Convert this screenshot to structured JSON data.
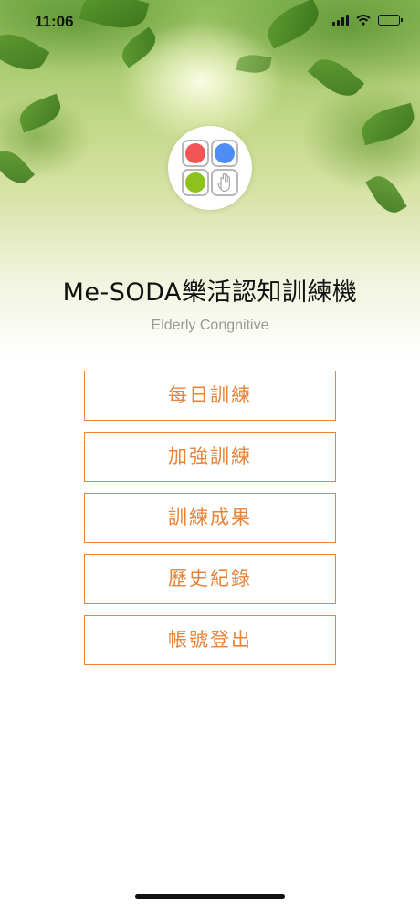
{
  "status_bar": {
    "time": "11:06"
  },
  "app": {
    "title": "Me-SODA樂活認知訓練機",
    "subtitle": "Elderly Congnitive"
  },
  "logo": {
    "colors": {
      "red": "#f25555",
      "blue": "#4f8df5",
      "green": "#8cc21b"
    },
    "icon": "hand-pointer-icon"
  },
  "menu": {
    "items": [
      {
        "label": "每日訓練"
      },
      {
        "label": "加強訓練"
      },
      {
        "label": "訓練成果"
      },
      {
        "label": "歷史紀錄"
      },
      {
        "label": "帳號登出"
      }
    ]
  },
  "colors": {
    "accent": "#e8843a",
    "title": "#111111",
    "subtitle": "#999999"
  }
}
